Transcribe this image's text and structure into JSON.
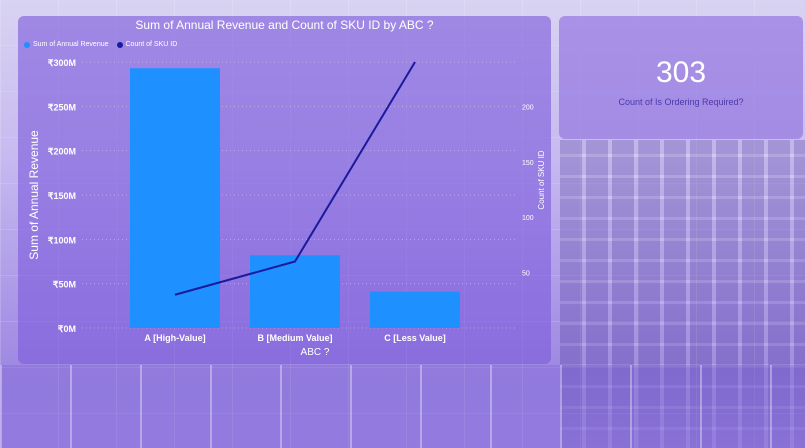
{
  "chart": {
    "title": "Sum of Annual Revenue and Count of SKU ID by ABC ?",
    "legend": [
      {
        "label": "Sum of Annual Revenue",
        "color": "#1e90ff"
      },
      {
        "label": "Count of SKU ID",
        "color": "#1a1a9c"
      }
    ]
  },
  "kpi": {
    "value": "303",
    "label": "Count of Is Ordering Required?"
  },
  "chart_data": {
    "type": "bar",
    "title": "Sum of Annual Revenue and Count of SKU ID by ABC ?",
    "xlabel": "ABC ?",
    "ylabel": "Sum of Annual Revenue",
    "y2label": "Count of SKU ID",
    "categories": [
      "A [High-Value]",
      "B [Medium Value]",
      "C [Less Value]"
    ],
    "series": [
      {
        "name": "Sum of Annual Revenue",
        "type": "bar",
        "axis": "left",
        "color": "#1e90ff",
        "values": [
          293,
          82,
          41
        ]
      },
      {
        "name": "Count of SKU ID",
        "type": "line",
        "axis": "right",
        "color": "#1a1a9c",
        "values": [
          30,
          60,
          240
        ]
      }
    ],
    "ylim": [
      0,
      300
    ],
    "yticks": [
      "₹0M",
      "₹50M",
      "₹100M",
      "₹150M",
      "₹200M",
      "₹250M",
      "₹300M"
    ],
    "y2lim": [
      0,
      240
    ],
    "y2ticks": [
      "50",
      "100",
      "150",
      "200"
    ],
    "grid": true,
    "legend_position": "top-left"
  }
}
